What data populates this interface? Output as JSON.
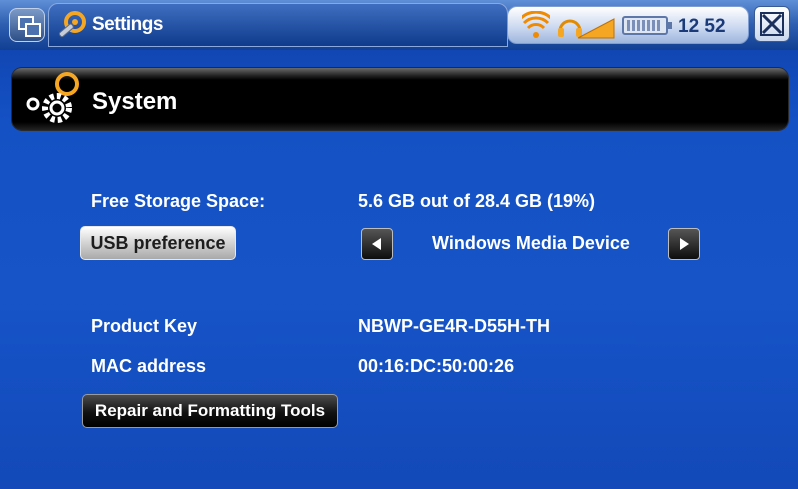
{
  "topbar": {
    "app_title": "Settings",
    "time": "12 52",
    "icons": [
      "window-switch-icon",
      "settings-gear-icon",
      "wifi-icon",
      "headphones-volume-icon",
      "battery-icon",
      "close-icon"
    ]
  },
  "header": {
    "title": "System",
    "icon": "gears-icon"
  },
  "system": {
    "free_storage_label": "Free Storage Space:",
    "free_storage_value": "5.6 GB out of 28.4 GB (19%)",
    "usb_preference_label": "USB preference",
    "usb_preference_value": "Windows Media Device",
    "product_key_label": "Product Key",
    "product_key_value": "NBWP-GE4R-D55H-TH",
    "mac_label": "MAC address",
    "mac_value": "00:16:DC:50:00:26",
    "repair_button_label": "Repair and Formatting Tools"
  },
  "colors": {
    "background": "#1654c8",
    "header_bar": "#000000",
    "text": "#ffffff",
    "accent_orange": "#f5a623"
  }
}
